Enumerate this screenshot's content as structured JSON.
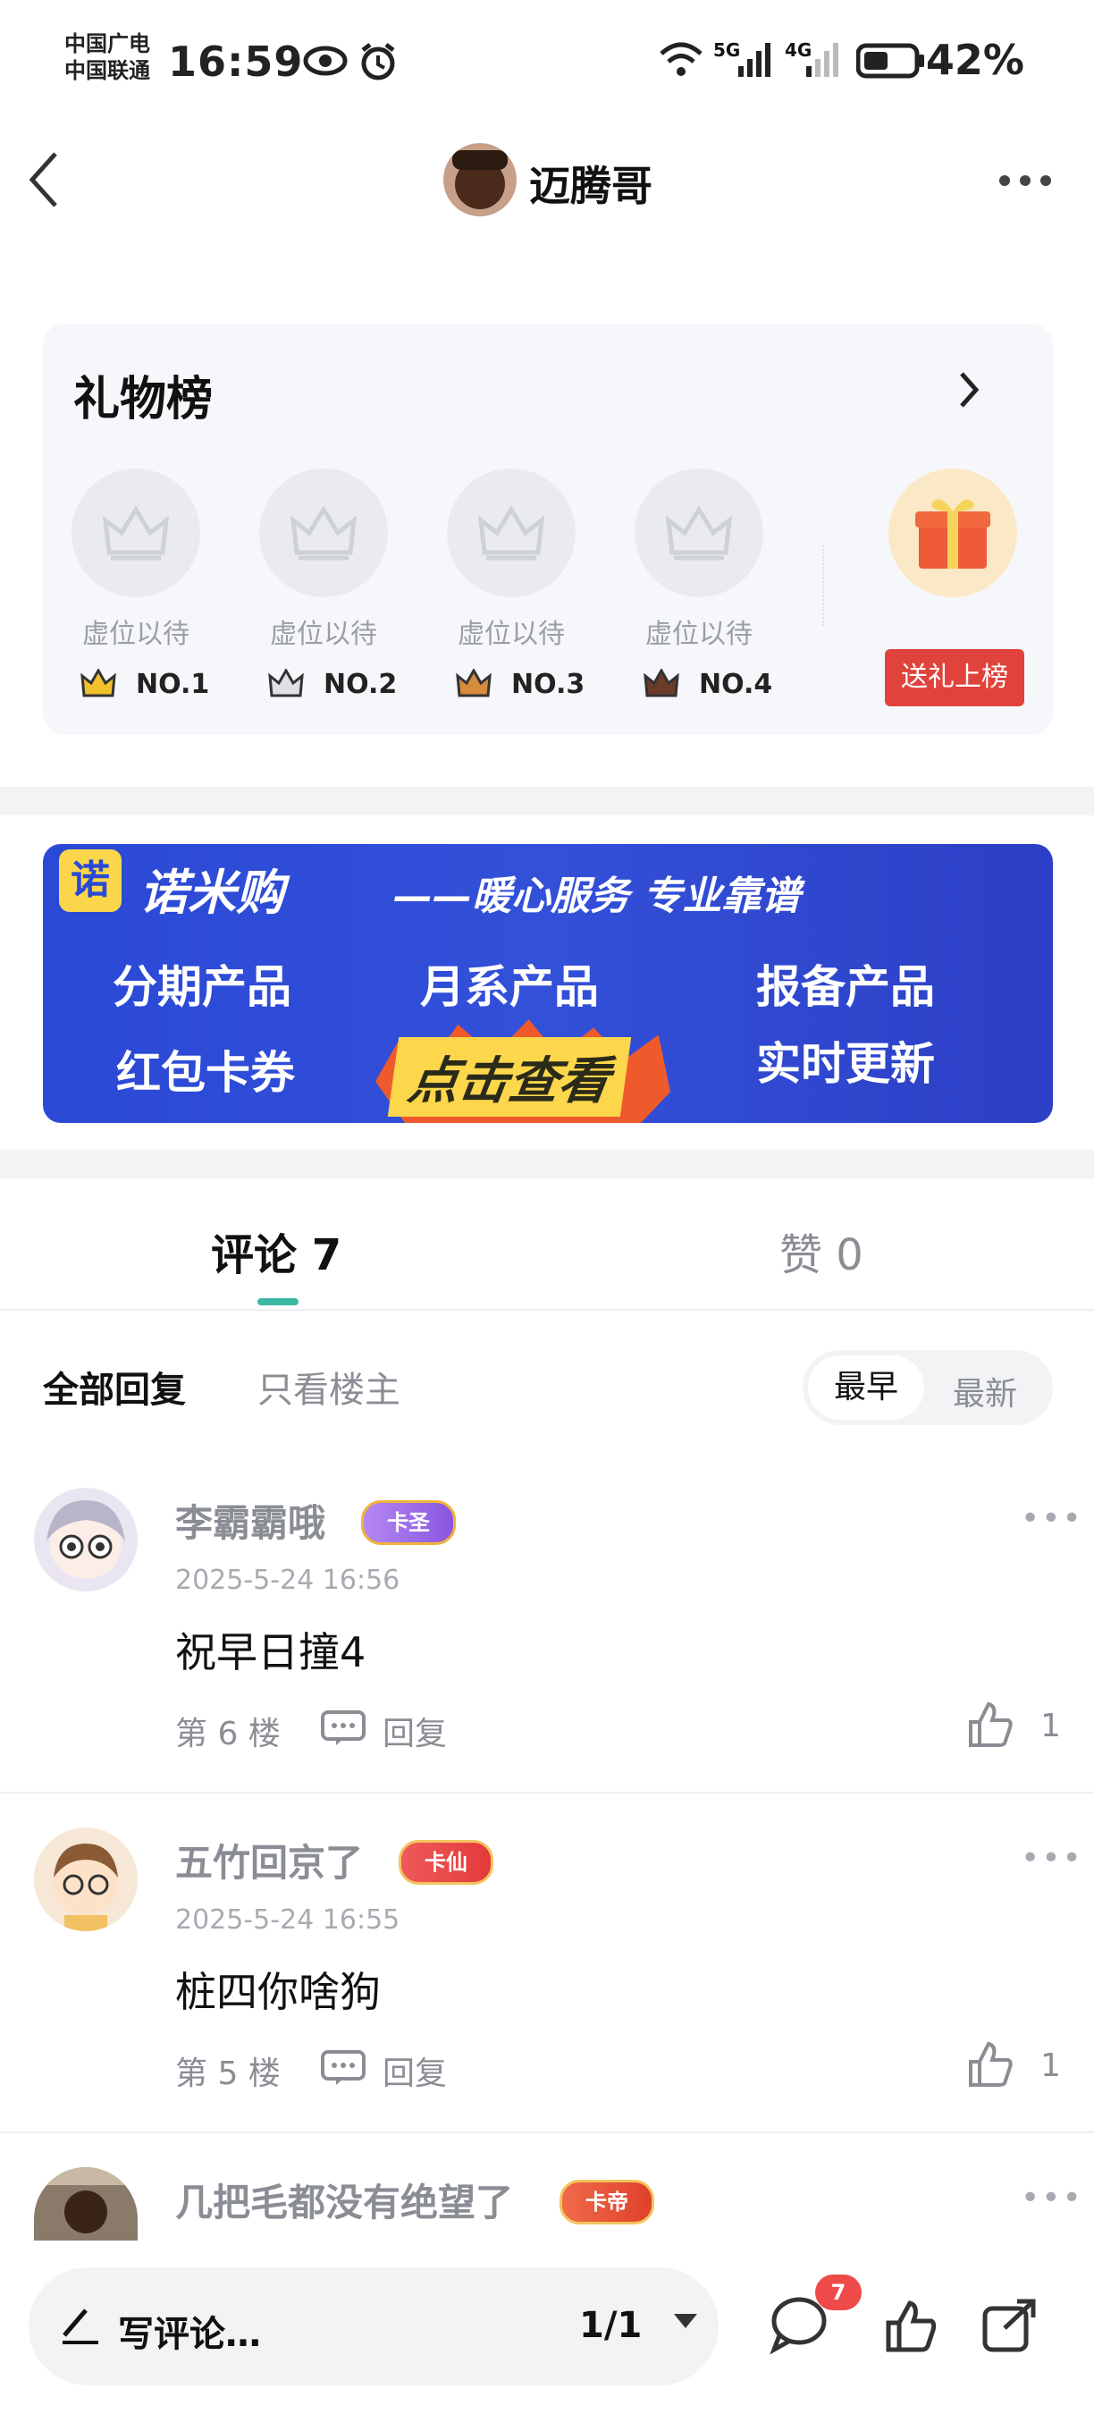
{
  "status_bar": {
    "carrier_1": "中国广电",
    "carrier_2": "中国联通",
    "time": "16:59",
    "network_1": "5G",
    "network_2": "4G",
    "battery": "42%"
  },
  "header": {
    "username": "迈腾哥"
  },
  "gift_board": {
    "title": "礼物榜",
    "slots": [
      {
        "label": "虚位以待",
        "rank": "NO.1"
      },
      {
        "label": "虚位以待",
        "rank": "NO.2"
      },
      {
        "label": "虚位以待",
        "rank": "NO.3"
      },
      {
        "label": "虚位以待",
        "rank": "NO.4"
      }
    ],
    "send_button": "送礼上榜",
    "colors": {
      "rank1": "#f2c12e",
      "rank2": "#8b8f98",
      "rank3": "#d58a3c",
      "rank4": "#6b3b2a"
    }
  },
  "banner": {
    "logo": "诺",
    "title": "诺米购",
    "subtitle": "——暖心服务 专业靠谱",
    "items": [
      "分期产品",
      "月系产品",
      "报备产品",
      "红包卡券",
      "实时更新"
    ],
    "cta": "点击查看"
  },
  "tabs": {
    "comments": "评论 7",
    "likes": "赞 0"
  },
  "filters": {
    "all": "全部回复",
    "host_only": "只看楼主",
    "sort_earliest": "最早",
    "sort_latest": "最新"
  },
  "comments": [
    {
      "user": "李霸霸哦",
      "badge": "卡圣",
      "time": "2025-5-24 16:56",
      "text": "祝早日撞4",
      "floor": "第 6 楼",
      "reply": "回复",
      "likes": "1"
    },
    {
      "user": "五竹回京了",
      "badge": "卡仙",
      "time": "2025-5-24 16:55",
      "text": "桩四你啥狗",
      "floor": "第 5 楼",
      "reply": "回复",
      "likes": "1"
    },
    {
      "user": "几把毛都没有绝望了",
      "badge": "卡帝"
    }
  ],
  "bottom_bar": {
    "input_placeholder": "写评论…",
    "page_indicator": "1/1",
    "message_count": "7"
  }
}
